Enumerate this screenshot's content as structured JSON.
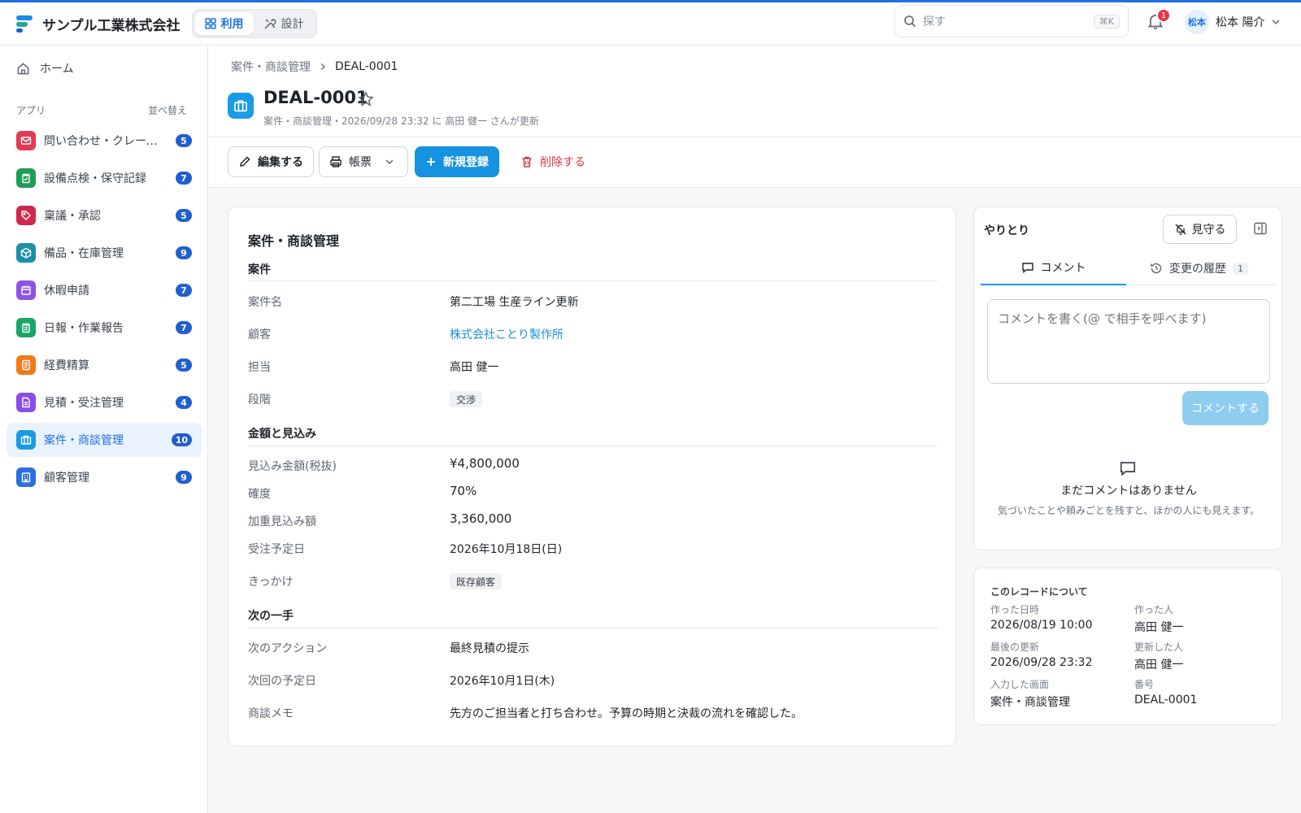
{
  "header": {
    "company": "サンプル工業株式会社",
    "mode_use": "利用",
    "mode_design": "設計",
    "search_placeholder": "探す",
    "search_shortcut": "⌘K",
    "notification_count": "1",
    "user_avatar": "松本",
    "user_name": "松本 陽介"
  },
  "sidebar": {
    "home": "ホーム",
    "section_label": "アプリ",
    "sort_label": "並べ替え",
    "items": [
      {
        "label": "問い合わせ・クレーム管理",
        "count": "5",
        "color": "#e23a55",
        "icon": "mail-icon"
      },
      {
        "label": "設備点検・保守記録",
        "count": "7",
        "color": "#1f9d55",
        "icon": "clipboard-icon"
      },
      {
        "label": "稟議・承認",
        "count": "5",
        "color": "#d1274f",
        "icon": "tag-icon"
      },
      {
        "label": "備品・在庫管理",
        "count": "9",
        "color": "#1e8fa8",
        "icon": "box-icon"
      },
      {
        "label": "休暇申請",
        "count": "7",
        "color": "#8a55e6",
        "icon": "calendar-icon"
      },
      {
        "label": "日報・作業報告",
        "count": "7",
        "color": "#18a567",
        "icon": "report-icon"
      },
      {
        "label": "経費精算",
        "count": "5",
        "color": "#f07a1a",
        "icon": "receipt-icon"
      },
      {
        "label": "見積・受注管理",
        "count": "4",
        "color": "#8a4ee6",
        "icon": "document-icon"
      },
      {
        "label": "案件・商談管理",
        "count": "10",
        "color": "#1a9be6",
        "icon": "briefcase-icon"
      },
      {
        "label": "顧客管理",
        "count": "9",
        "color": "#2b6fe0",
        "icon": "building-icon"
      }
    ]
  },
  "page": {
    "breadcrumb_parent": "案件・商談管理",
    "breadcrumb_current": "DEAL-0001",
    "title": "DEAL-0001",
    "subtitle": "案件・商談管理・2026/09/28 23:32 に 高田 健一 さんが更新"
  },
  "toolbar": {
    "edit": "編集する",
    "print": "帳票",
    "new": "新規登録",
    "delete": "削除する"
  },
  "record": {
    "card_title": "案件・商談管理",
    "groups": [
      {
        "title": "案件",
        "fields": [
          {
            "label": "案件名",
            "value": "第二工場 生産ライン更新"
          },
          {
            "label": "顧客",
            "value": "株式会社ことり製作所"
          },
          {
            "label": "担当",
            "value": "高田 健一"
          },
          {
            "label": "段階",
            "value": "交渉"
          }
        ]
      },
      {
        "title": "金額と見込み",
        "fields": [
          {
            "label": "見込み金額(税抜)",
            "value": "¥4,800,000"
          },
          {
            "label": "確度",
            "value": "70%"
          },
          {
            "label": "加重見込み額",
            "value": "3,360,000"
          },
          {
            "label": "受注予定日",
            "value": "2026年10月18日(日)"
          },
          {
            "label": "きっかけ",
            "value": "既存顧客"
          }
        ]
      },
      {
        "title": "次の一手",
        "fields": [
          {
            "label": "次のアクション",
            "value": "最終見積の提示"
          },
          {
            "label": "次回の予定日",
            "value": "2026年10月1日(木)"
          },
          {
            "label": "商談メモ",
            "value": "先方のご担当者と打ち合わせ。予算の時期と決裁の流れを確認した。"
          }
        ]
      }
    ]
  },
  "activity": {
    "title": "やりとり",
    "watch": "見守る",
    "tab_comment": "コメント",
    "tab_history": "変更の履歴",
    "history_count": "1",
    "comment_placeholder": "コメントを書く(@ で相手を呼べます)",
    "comment_button": "コメントする",
    "empty_title": "まだコメントはありません",
    "empty_desc": "気づいたことや頼みごとを残すと、ほかの人にも見えます。"
  },
  "meta": {
    "title": "このレコードについて",
    "created_at_label": "作った日時",
    "created_at": "2026/08/19 10:00",
    "created_by_label": "作った人",
    "created_by": "高田 健一",
    "updated_at_label": "最後の更新",
    "updated_at": "2026/09/28 23:32",
    "updated_by_label": "更新した人",
    "updated_by": "高田 健一",
    "screen_label": "入力した画面",
    "screen": "案件・商談管理",
    "number_label": "番号",
    "number": "DEAL-0001"
  }
}
